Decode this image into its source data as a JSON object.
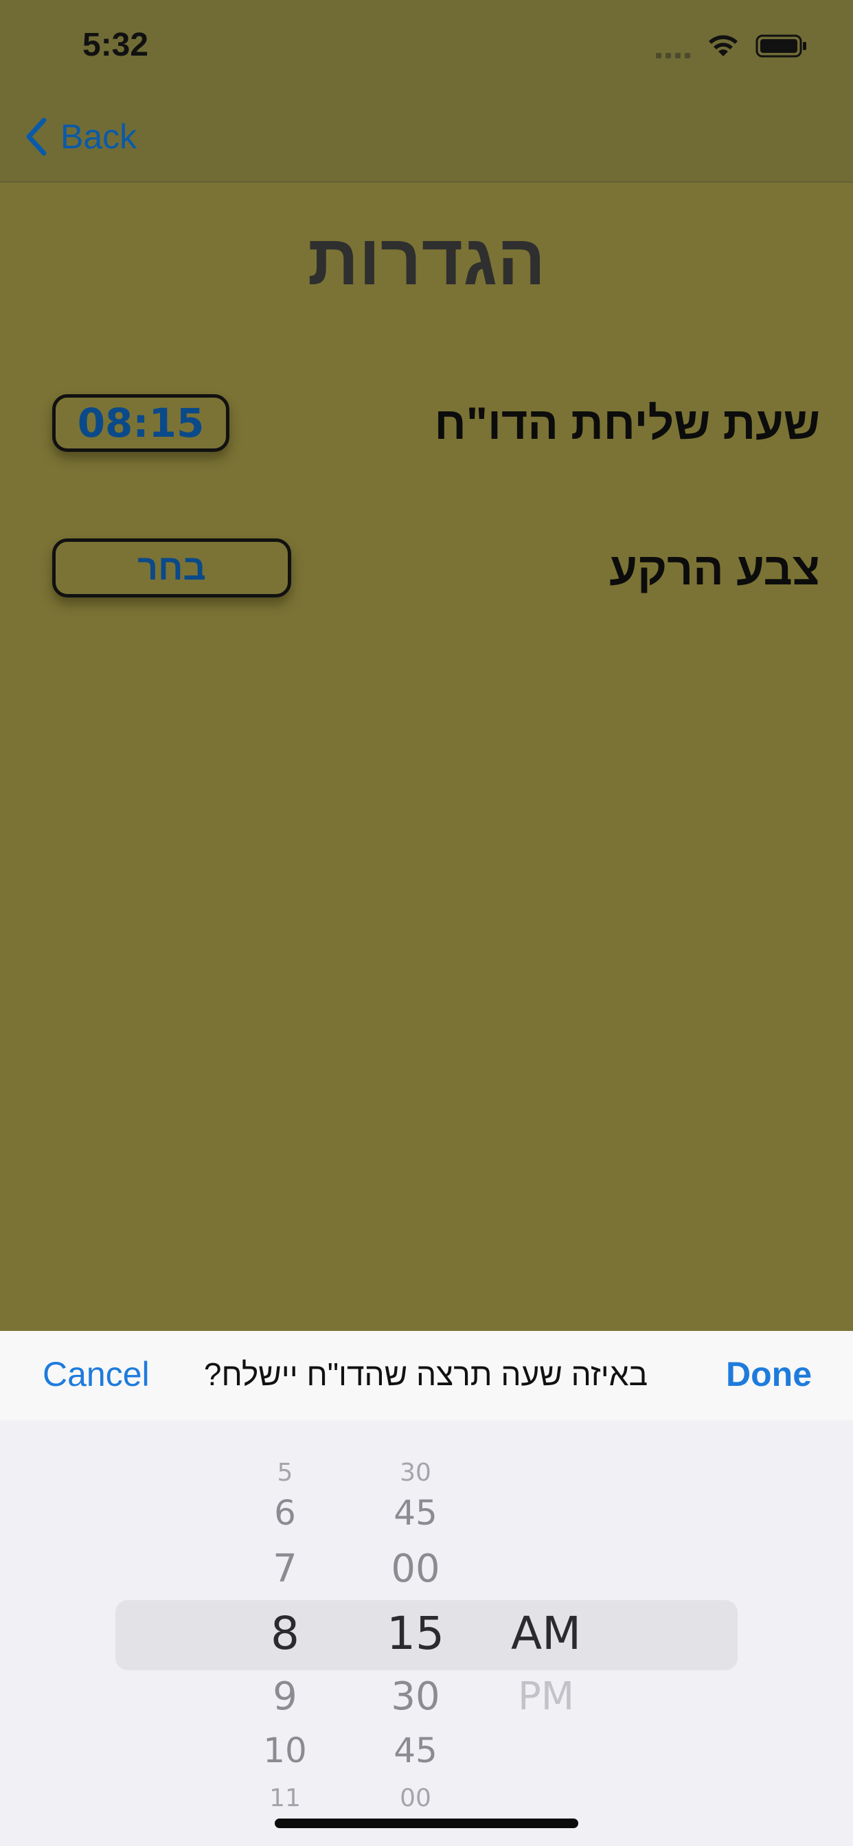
{
  "status": {
    "time": "5:32"
  },
  "nav": {
    "back_label": "Back"
  },
  "page": {
    "title": "הגדרות"
  },
  "settings": {
    "report_time_label": "שעת שליחת הדו\"ח",
    "report_time_value": "08:15",
    "background_color_label": "צבע הרקע",
    "choose_label": "בחר"
  },
  "picker_toolbar": {
    "cancel_label": "Cancel",
    "title": "באיזה שעה תרצה שהדו\"ח יישלח?",
    "done_label": "Done"
  },
  "time_picker": {
    "hours": [
      "5",
      "6",
      "7",
      "8",
      "9",
      "10",
      "11"
    ],
    "minutes": [
      "30",
      "45",
      "00",
      "15",
      "30",
      "45",
      "00"
    ],
    "periods": [
      "AM",
      "PM"
    ],
    "selected": {
      "hour": "8",
      "minute": "15",
      "period": "AM"
    }
  },
  "colors": {
    "background": "#7b7335",
    "accent": "#1e7bdc",
    "button_text": "#0b4a8a"
  }
}
